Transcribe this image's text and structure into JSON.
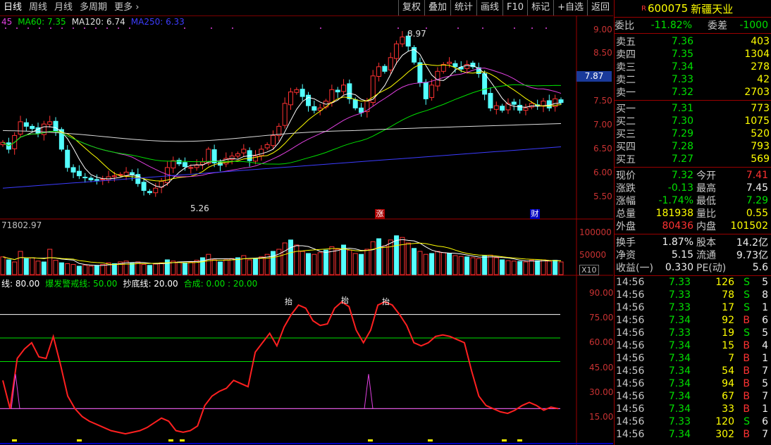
{
  "toolbar": {
    "tabs": [
      "日线",
      "周线",
      "月线",
      "多周期",
      "更多"
    ],
    "buttons": [
      "复权",
      "叠加",
      "统计",
      "画线",
      "F10",
      "标记",
      "+自选",
      "返回"
    ]
  },
  "ma_legend": [
    {
      "text": "45",
      "color": "#e040e0"
    },
    {
      "text": "MA60: 7.35",
      "color": "#00e000"
    },
    {
      "text": "MA120: 6.74",
      "color": "#e0e0e0"
    },
    {
      "text": "MA250: 6.33",
      "color": "#3c3cff"
    }
  ],
  "price_axis": [
    "9.00",
    "8.50",
    "8.00",
    "7.50",
    "7.00",
    "6.50",
    "6.00",
    "5.50"
  ],
  "current_price_tag": "7.87",
  "high_marker": "8.97",
  "low_marker": "5.26",
  "event_markers": {
    "zhang": "涨",
    "cai": "财"
  },
  "volume_header": "71802.97",
  "volume_axis": [
    "100000",
    "50000"
  ],
  "volume_unit": "X10",
  "indicator_legend": [
    {
      "text": "线: 80.00",
      "color": "#ffffff"
    },
    {
      "text": "爆发警戒线: 50.00",
      "color": "#00e000"
    },
    {
      "text": "抄底线: 20.00",
      "color": "#ffffff"
    },
    {
      "text": "合成: 0.00 : 20.00",
      "color": "#00e000"
    }
  ],
  "indicator_axis": [
    "90.00",
    "75.00",
    "60.00",
    "45.00",
    "30.00",
    "15.00"
  ],
  "indicator_labels": [
    "抬",
    "抬",
    "抬"
  ],
  "stock": {
    "code": "600075",
    "name": "新疆天业",
    "flag": "R"
  },
  "weibi": {
    "label": "委比",
    "value": "-11.82%",
    "label2": "委差",
    "value2": "-1000"
  },
  "asks": [
    {
      "label": "卖五",
      "price": "7.36",
      "vol": "403"
    },
    {
      "label": "卖四",
      "price": "7.35",
      "vol": "1304"
    },
    {
      "label": "卖三",
      "price": "7.34",
      "vol": "278"
    },
    {
      "label": "卖二",
      "price": "7.33",
      "vol": "42"
    },
    {
      "label": "卖一",
      "price": "7.32",
      "vol": "2703"
    }
  ],
  "bids": [
    {
      "label": "买一",
      "price": "7.31",
      "vol": "773"
    },
    {
      "label": "买二",
      "price": "7.30",
      "vol": "1075"
    },
    {
      "label": "买三",
      "price": "7.29",
      "vol": "520"
    },
    {
      "label": "买四",
      "price": "7.28",
      "vol": "793"
    },
    {
      "label": "买五",
      "price": "7.27",
      "vol": "569"
    }
  ],
  "quote": [
    {
      "l1": "现价",
      "v1": "7.32",
      "c1": "g",
      "l2": "今开",
      "v2": "7.41",
      "c2": "r"
    },
    {
      "l1": "涨跌",
      "v1": "-0.13",
      "c1": "g",
      "l2": "最高",
      "v2": "7.45",
      "c2": "w"
    },
    {
      "l1": "涨幅",
      "v1": "-1.74%",
      "c1": "g",
      "l2": "最低",
      "v2": "7.29",
      "c2": "g"
    },
    {
      "l1": "总量",
      "v1": "181938",
      "c1": "y",
      "l2": "量比",
      "v2": "0.55",
      "c2": "y"
    },
    {
      "l1": "外盘",
      "v1": "80436",
      "c1": "r",
      "l2": "内盘",
      "v2": "101502",
      "c2": "y"
    }
  ],
  "fund": [
    {
      "l1": "换手",
      "v1": "1.87%",
      "l2": "股本",
      "v2": "14.2亿"
    },
    {
      "l1": "净资",
      "v1": "5.15",
      "l2": "流通",
      "v2": "9.73亿"
    },
    {
      "l1": "收益(一)",
      "v1": "0.330",
      "l2": "PE(动)",
      "v2": "5.6"
    }
  ],
  "ticks": [
    {
      "time": "14:56",
      "price": "7.33",
      "vol": "126",
      "bs": "S",
      "n": "5"
    },
    {
      "time": "14:56",
      "price": "7.33",
      "vol": "78",
      "bs": "S",
      "n": "8"
    },
    {
      "time": "14:56",
      "price": "7.33",
      "vol": "17",
      "bs": "S",
      "n": "1"
    },
    {
      "time": "14:56",
      "price": "7.34",
      "vol": "92",
      "bs": "B",
      "n": "6"
    },
    {
      "time": "14:56",
      "price": "7.33",
      "vol": "19",
      "bs": "S",
      "n": "5"
    },
    {
      "time": "14:56",
      "price": "7.34",
      "vol": "15",
      "bs": "B",
      "n": "4"
    },
    {
      "time": "14:56",
      "price": "7.34",
      "vol": "7",
      "bs": "B",
      "n": "1"
    },
    {
      "time": "14:56",
      "price": "7.34",
      "vol": "54",
      "bs": "B",
      "n": "7"
    },
    {
      "time": "14:56",
      "price": "7.34",
      "vol": "94",
      "bs": "B",
      "n": "5"
    },
    {
      "time": "14:56",
      "price": "7.34",
      "vol": "67",
      "bs": "B",
      "n": "7"
    },
    {
      "time": "14:56",
      "price": "7.34",
      "vol": "33",
      "bs": "B",
      "n": "1"
    },
    {
      "time": "14:56",
      "price": "7.33",
      "vol": "120",
      "bs": "S",
      "n": "6"
    },
    {
      "time": "14:56",
      "price": "7.34",
      "vol": "302",
      "bs": "B",
      "n": "7"
    }
  ],
  "chart_data": {
    "type": "candlestick",
    "close_series": [
      6.45,
      6.3,
      6.6,
      6.9,
      6.8,
      6.75,
      6.65,
      6.85,
      6.9,
      6.7,
      6.3,
      5.9,
      5.8,
      5.72,
      5.68,
      5.63,
      5.62,
      5.65,
      5.7,
      5.72,
      5.75,
      5.8,
      5.74,
      5.55,
      5.4,
      5.35,
      5.45,
      5.6,
      5.9,
      6.05,
      5.98,
      5.92,
      5.9,
      5.95,
      6.02,
      6.3,
      6.0,
      5.95,
      6.1,
      6.15,
      6.2,
      6.3,
      6.05,
      6.15,
      6.3,
      6.4,
      6.6,
      6.8,
      7.3,
      7.55,
      7.6,
      7.45,
      7.25,
      7.15,
      7.2,
      7.35,
      7.6,
      7.55,
      7.7,
      7.4,
      7.2,
      7.1,
      7.35,
      7.9,
      8.1,
      8.0,
      8.3,
      8.6,
      8.75,
      8.55,
      8.2,
      7.75,
      7.4,
      7.7,
      8.0,
      8.15,
      8.2,
      8.1,
      8.05,
      8.15,
      8.1,
      7.95,
      7.5,
      7.2,
      7.25,
      7.15,
      7.3,
      7.28,
      7.15,
      7.2,
      7.3,
      7.25,
      7.35,
      7.2,
      7.4,
      7.32
    ],
    "volume": [
      42,
      35,
      30,
      55,
      38,
      40,
      32,
      30,
      60,
      34,
      28,
      26,
      24,
      20,
      22,
      20,
      22,
      24,
      28,
      26,
      30,
      32,
      27,
      30,
      24,
      22,
      25,
      28,
      35,
      32,
      30,
      28,
      30,
      34,
      40,
      48,
      35,
      30,
      35,
      38,
      40,
      45,
      35,
      38,
      42,
      48,
      55,
      60,
      75,
      82,
      70,
      55,
      50,
      48,
      52,
      58,
      66,
      60,
      70,
      58,
      50,
      48,
      60,
      78,
      85,
      68,
      82,
      92,
      88,
      75,
      62,
      55,
      48,
      50,
      55,
      52,
      50,
      45,
      43,
      42,
      40,
      38,
      44,
      46,
      40,
      35,
      33,
      32,
      31,
      30,
      34,
      33,
      35,
      32,
      34,
      30
    ],
    "indicator": [
      38,
      20,
      52,
      58,
      62,
      53,
      52,
      66,
      48,
      28,
      20,
      15,
      12,
      10,
      8,
      6,
      5,
      4,
      5,
      6,
      8,
      11,
      14,
      12,
      6,
      5,
      6,
      9,
      22,
      28,
      31,
      33,
      38,
      36,
      34,
      56,
      62,
      68,
      60,
      72,
      80,
      86,
      84,
      76,
      73,
      74,
      84,
      88,
      85,
      70,
      62,
      70,
      86,
      88,
      86,
      80,
      73,
      62,
      60,
      62,
      66,
      67,
      66,
      64,
      62,
      44,
      28,
      22,
      20,
      18,
      17,
      19,
      22,
      24,
      22,
      19,
      21,
      20
    ],
    "ylim": [
      5.1,
      9.2
    ]
  }
}
